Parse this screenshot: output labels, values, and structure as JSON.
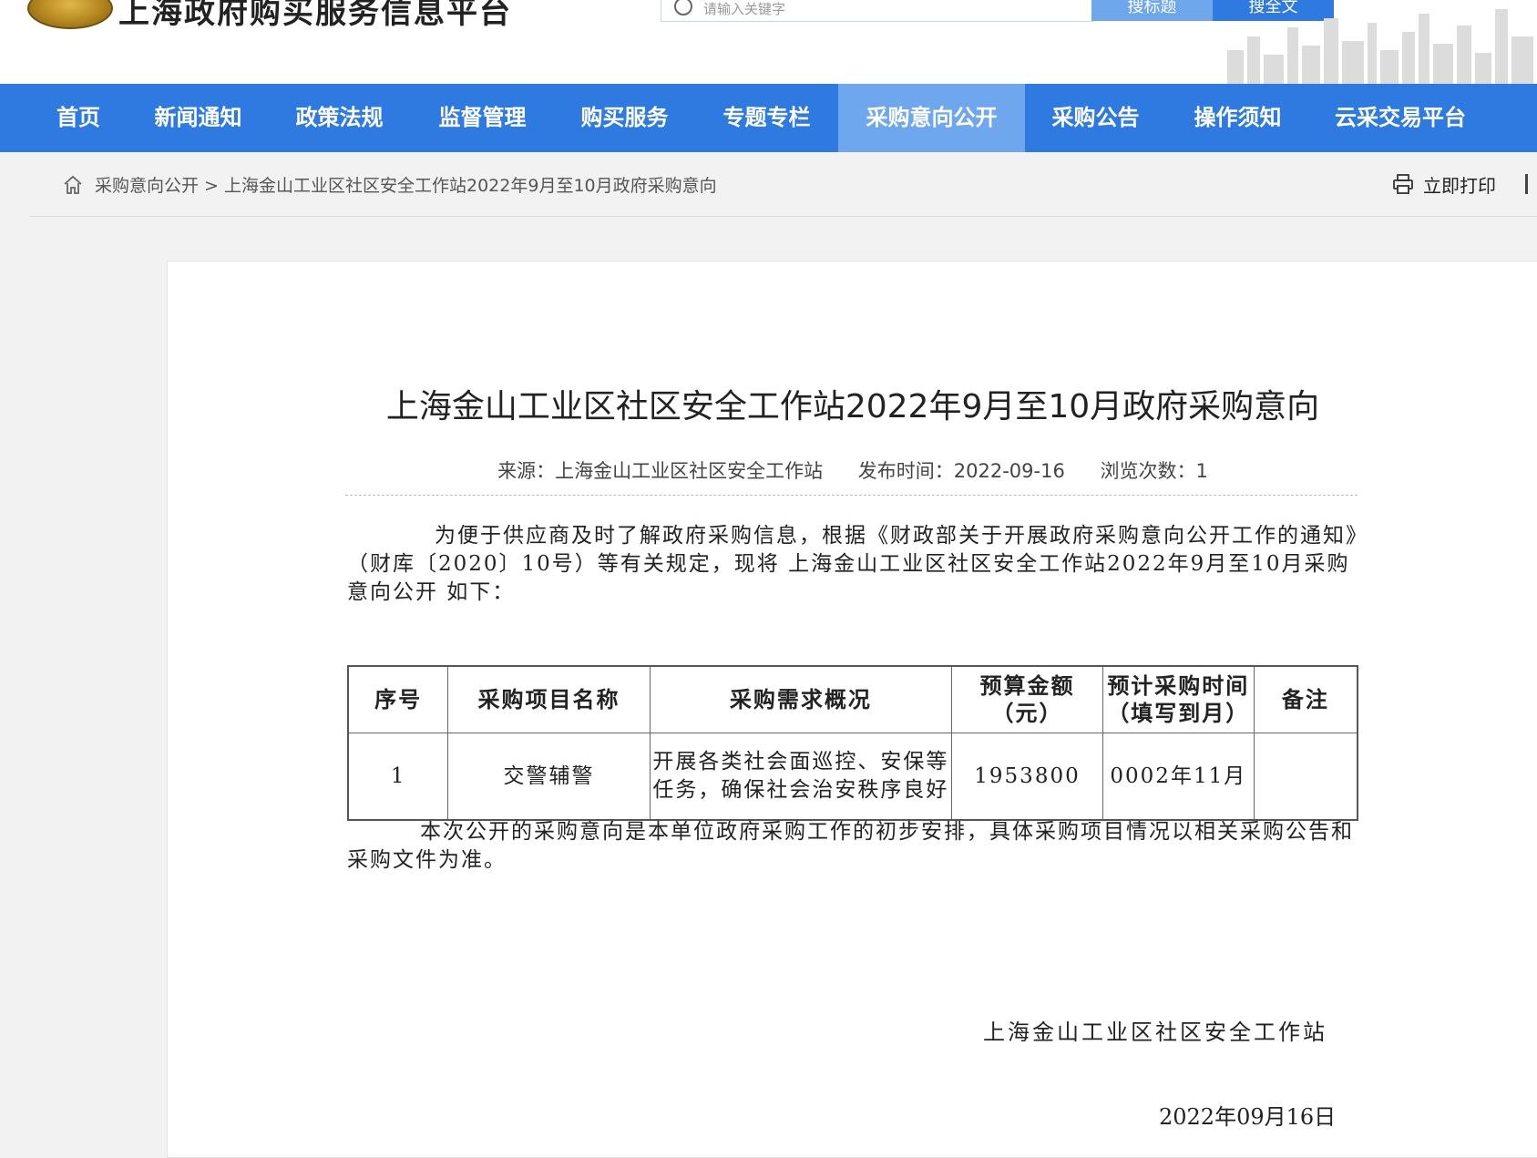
{
  "header": {
    "site_title": "上海政府购买服务信息平台",
    "search_placeholder": "请输入关键字",
    "search_title_button": "搜标题",
    "search_full_button": "搜全文"
  },
  "nav": {
    "items": [
      {
        "label": "首页"
      },
      {
        "label": "新闻通知"
      },
      {
        "label": "政策法规"
      },
      {
        "label": "监督管理"
      },
      {
        "label": "购买服务"
      },
      {
        "label": "专题专栏"
      },
      {
        "label": "采购意向公开",
        "active": true
      },
      {
        "label": "采购公告"
      },
      {
        "label": "操作须知"
      },
      {
        "label": "云采交易平台"
      }
    ]
  },
  "breadcrumb": {
    "text": "采购意向公开 > 上海金山工业区社区安全工作站2022年9月至10月政府采购意向",
    "print_label": "立即打印"
  },
  "article": {
    "title": "上海金山工业区社区安全工作站2022年9月至10月政府采购意向",
    "meta": {
      "source": "来源：上海金山工业区社区安全工作站",
      "published": "发布时间：2022-09-16",
      "views": "浏览次数：1"
    },
    "intro": "为便于供应商及时了解政府采购信息，根据《财政部关于开展政府采购意向公开工作的通知》（财库〔2020〕10号）等有关规定，现将 上海金山工业区社区安全工作站2022年9月至10月采购意向公开 如下：",
    "table": {
      "headers": [
        "序号",
        "采购项目名称",
        "采购需求概况",
        "预算金额（元）",
        "预计采购时间（填写到月）",
        "备注"
      ],
      "rows": [
        [
          "1",
          "交警辅警",
          "开展各类社会面巡控、安保等任务，确保社会治安秩序良好",
          "1953800",
          "0002年11月",
          ""
        ]
      ]
    },
    "closing": "本次公开的采购意向是本单位政府采购工作的初步安排，具体采购项目情况以相关采购公告和采购文件为准。",
    "signature_org": "上海金山工业区社区安全工作站",
    "signature_date": "2022年09月16日"
  },
  "colors": {
    "nav_blue": "#2f7ae0",
    "nav_active": "#6fa7ef"
  }
}
